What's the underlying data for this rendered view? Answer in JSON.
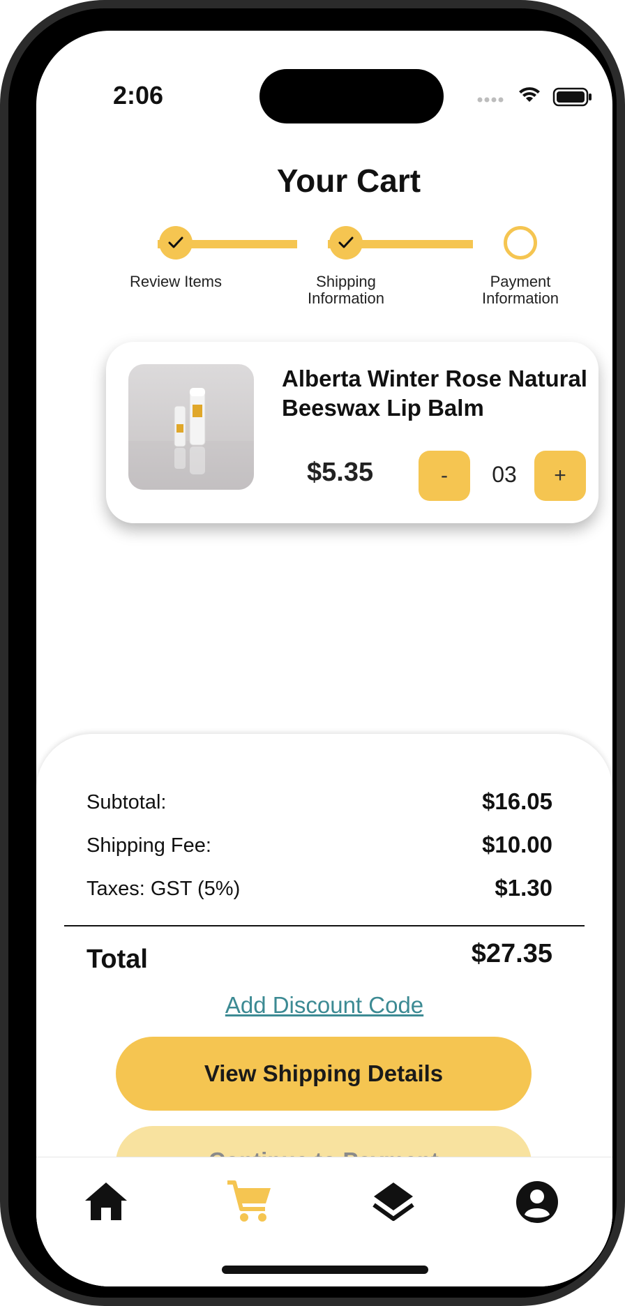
{
  "status_bar": {
    "time": "2:06"
  },
  "header": {
    "title": "Your Cart"
  },
  "progress_steps": [
    {
      "label": "Review Items",
      "completed": true
    },
    {
      "label": "Shipping Information",
      "completed": true
    },
    {
      "label": "Payment Information",
      "completed": false
    }
  ],
  "cart_item": {
    "name": "Alberta Winter Rose Natural Beeswax Lip Balm",
    "price": "$5.35",
    "quantity": "03",
    "decrement_label": "-",
    "increment_label": "+"
  },
  "summary": {
    "subtotal_label": "Subtotal:",
    "subtotal_value": "$16.05",
    "shipping_label": "Shipping Fee:",
    "shipping_value": "$10.00",
    "taxes_label": "Taxes: GST (5%)",
    "taxes_value": "$1.30",
    "total_label": "Total",
    "total_value": "$27.35",
    "discount_link": "Add Discount Code",
    "primary_button": "View Shipping Details",
    "secondary_button": "Continue to Payment"
  },
  "tab_bar": {
    "items": [
      "home-icon",
      "cart-icon",
      "layers-icon",
      "account-icon"
    ],
    "active": "cart-icon"
  },
  "colors": {
    "accent": "#f5c551",
    "accent_light": "#f8e29f",
    "link": "#3c8a93",
    "text": "#111111"
  }
}
